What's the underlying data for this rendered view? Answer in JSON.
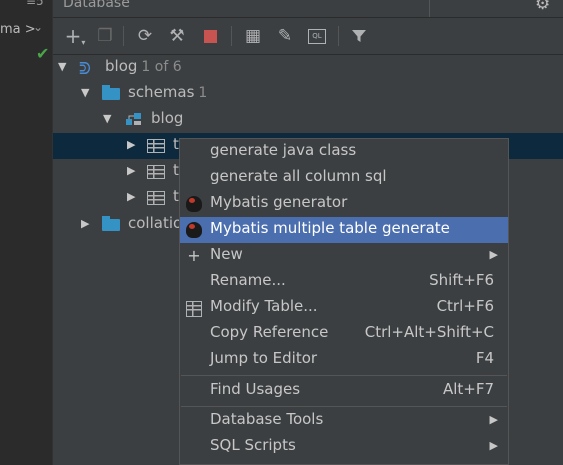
{
  "left": {
    "scheme_label": "ma >",
    "lines_label": "≡5"
  },
  "header": {
    "title": "Database"
  },
  "tree": {
    "root": {
      "label": "blog",
      "count": "1 of 6"
    },
    "schemas": {
      "label": "schemas",
      "count": "1"
    },
    "schema": {
      "label": "blog"
    },
    "tables": [
      "t",
      "t",
      "t"
    ],
    "collations": {
      "label": "collatio"
    }
  },
  "menu": {
    "items": [
      {
        "label": "generate java class",
        "shortcut": ""
      },
      {
        "label": "generate all column sql",
        "shortcut": ""
      },
      {
        "label": "Mybatis generator",
        "shortcut": ""
      },
      {
        "label": "Mybatis multiple table generate",
        "shortcut": ""
      },
      {
        "label": "New",
        "shortcut": ""
      },
      {
        "label": "Rename...",
        "shortcut": "Shift+F6"
      },
      {
        "label": "Modify Table...",
        "shortcut": "Ctrl+F6"
      },
      {
        "label": "Copy Reference",
        "shortcut": "Ctrl+Alt+Shift+C"
      },
      {
        "label": "Jump to Editor",
        "shortcut": "F4"
      },
      {
        "label": "Find Usages",
        "shortcut": "Alt+F7"
      },
      {
        "label": "Database Tools",
        "shortcut": ""
      },
      {
        "label": "SQL Scripts",
        "shortcut": ""
      }
    ]
  },
  "colors": {
    "selection": "#4b6eaf",
    "folder": "#3592c4",
    "tree_selection": "#0d293e"
  }
}
